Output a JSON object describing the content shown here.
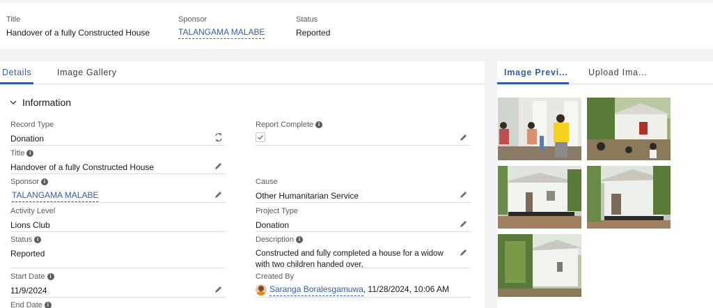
{
  "header": {
    "title_label": "Title",
    "title_value": "Handover of a fully Constructed House",
    "sponsor_label": "Sponsor",
    "sponsor_value": "TALANGAMA MALABE",
    "status_label": "Status",
    "status_value": "Reported"
  },
  "tabs": {
    "details": "Details",
    "image_gallery": "Image Gallery"
  },
  "section": {
    "title": "Information"
  },
  "fields": {
    "record_type": {
      "label": "Record Type",
      "value": "Donation"
    },
    "report_complete": {
      "label": "Report Complete",
      "checked": true
    },
    "title": {
      "label": "Title",
      "value": "Handover of a fully Constructed House"
    },
    "sponsor": {
      "label": "Sponsor",
      "value": "TALANGAMA MALABE"
    },
    "cause": {
      "label": "Cause",
      "value": "Other Humanitarian Service"
    },
    "activity_level": {
      "label": "Activity Level",
      "value": "Lions Club"
    },
    "project_type": {
      "label": "Project Type",
      "value": "Donation"
    },
    "status": {
      "label": "Status",
      "value": "Reported"
    },
    "description": {
      "label": "Description",
      "value": "Constructed and fully completed a house for a widow with two children handed over,"
    },
    "start_date": {
      "label": "Start Date",
      "value": "11/9/2024"
    },
    "created_by": {
      "label": "Created By",
      "user": "Saranga Boralesgamuwa",
      "timestamp": ", 11/28/2024, 10:06 AM"
    },
    "end_date": {
      "label": "End Date"
    }
  },
  "side_tabs": {
    "image_preview": "Image Previ...",
    "upload_image": "Upload Ima..."
  },
  "colors": {
    "accent": "#2f5ea8",
    "divider": "#dddbda",
    "background": "#f3f3f3"
  },
  "icons": [
    "chevron-down-icon",
    "info-icon",
    "edit-icon",
    "change-record-type-icon",
    "checkbox-checked-icon",
    "user-avatar"
  ]
}
